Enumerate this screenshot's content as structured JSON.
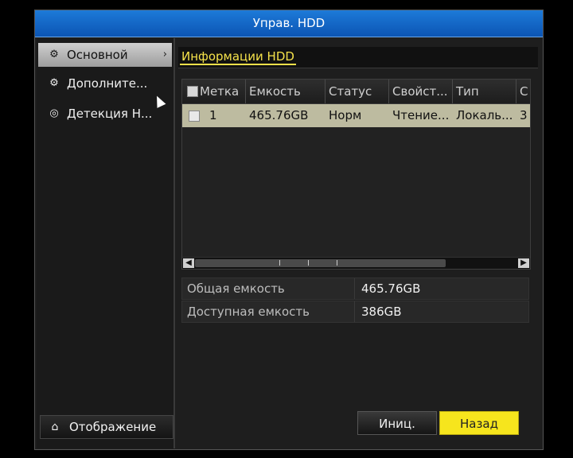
{
  "window": {
    "title": "Управ. HDD"
  },
  "sidebar": {
    "items": [
      {
        "label": "Основной",
        "icon": "gear-icon",
        "active": true
      },
      {
        "label": "Дополните...",
        "icon": "gears-icon",
        "active": false
      },
      {
        "label": "Детекция Н...",
        "icon": "shield-icon",
        "active": false
      }
    ],
    "display_button": {
      "label": "Отображение",
      "icon": "home-icon"
    }
  },
  "main": {
    "tab": "Информации HDD",
    "table": {
      "columns": [
        "Метка",
        "Емкость",
        "Статус",
        "Свойст...",
        "Тип",
        "С"
      ],
      "rows": [
        {
          "label": "1",
          "capacity": "465.76GB",
          "status": "Норм",
          "property": "Чтение...",
          "type": "Локаль...",
          "extra": "3"
        }
      ]
    },
    "info": {
      "total_label": "Общая емкость",
      "total_value": "465.76GB",
      "free_label": "Доступная емкость",
      "free_value": "386GB"
    },
    "buttons": {
      "init": "Иниц.",
      "back": "Назад"
    }
  },
  "colors": {
    "accent_yellow": "#f6e51d",
    "title_blue": "#1d7ad8",
    "selected_row": "#bdbba0"
  }
}
